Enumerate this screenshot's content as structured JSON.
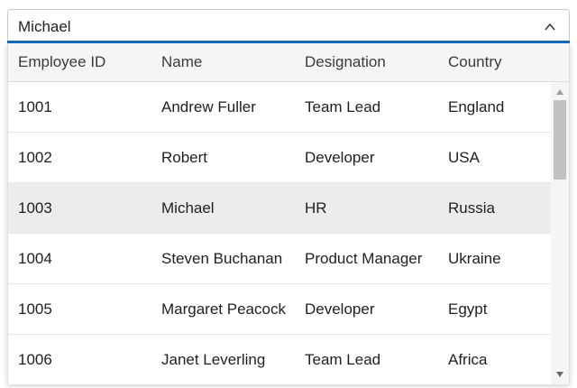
{
  "combobox": {
    "value": "Michael",
    "icon": "chevron-up-icon",
    "accent_color": "#0f6cbd"
  },
  "grid": {
    "columns": [
      "Employee ID",
      "Name",
      "Designation",
      "Country"
    ],
    "rows": [
      {
        "id": "1001",
        "name": "Andrew Fuller",
        "designation": "Team Lead",
        "country": "England",
        "selected": false
      },
      {
        "id": "1002",
        "name": "Robert",
        "designation": "Developer",
        "country": "USA",
        "selected": false
      },
      {
        "id": "1003",
        "name": "Michael",
        "designation": "HR",
        "country": "Russia",
        "selected": true
      },
      {
        "id": "1004",
        "name": "Steven Buchanan",
        "designation": "Product Manager",
        "country": "Ukraine",
        "selected": false
      },
      {
        "id": "1005",
        "name": "Margaret Peacock",
        "designation": "Developer",
        "country": "Egypt",
        "selected": false
      },
      {
        "id": "1006",
        "name": "Janet Leverling",
        "designation": "Team Lead",
        "country": "Africa",
        "selected": false
      }
    ],
    "selected_row_color": "#ececec",
    "header_color": "#f5f5f5"
  }
}
